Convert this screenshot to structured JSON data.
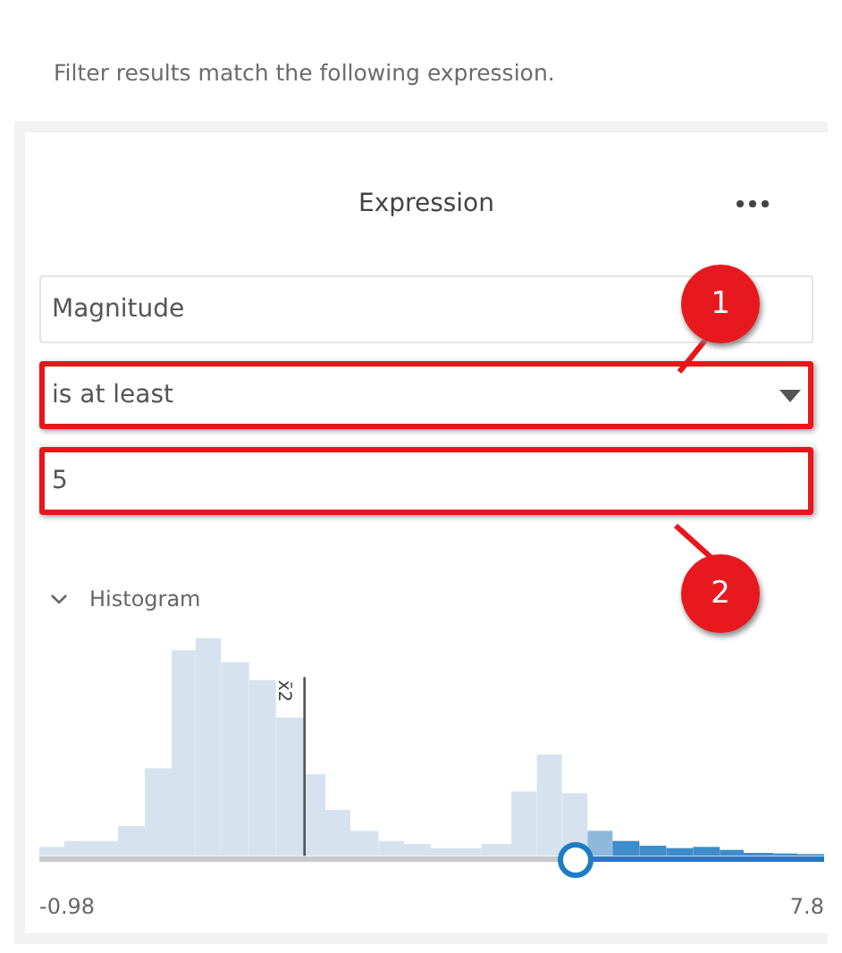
{
  "intro": "Filter results match the following expression.",
  "panel": {
    "title": "Expression"
  },
  "field": {
    "value": "Magnitude"
  },
  "operator": {
    "value": "is at least",
    "highlighted": true
  },
  "input": {
    "value": "5",
    "highlighted": true
  },
  "histogram": {
    "label": "Histogram",
    "expanded": true,
    "mean_label": "x̄2",
    "min": "-0.98",
    "max": "7.8",
    "level": 0.68
  },
  "callouts": [
    {
      "label": "1"
    },
    {
      "label": "2"
    }
  ]
}
